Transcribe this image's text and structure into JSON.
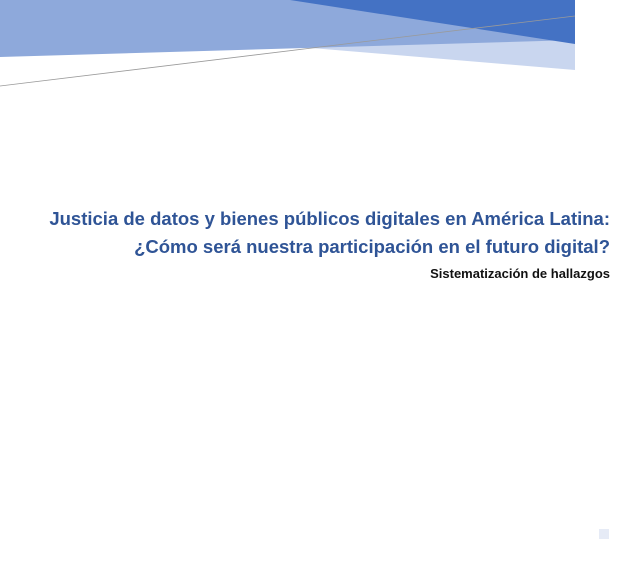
{
  "document": {
    "title_line_1": "Justicia de datos y bienes públicos digitales en América Latina:",
    "title_line_2": "¿Cómo será nuestra participación en el futuro digital?",
    "subtitle": "Sistematización de hallazgos"
  },
  "colors": {
    "title": "#2f5496",
    "banner_dark": "#4472c4",
    "banner_mid": "#8ea9db",
    "banner_light": "#c9d6ef"
  }
}
